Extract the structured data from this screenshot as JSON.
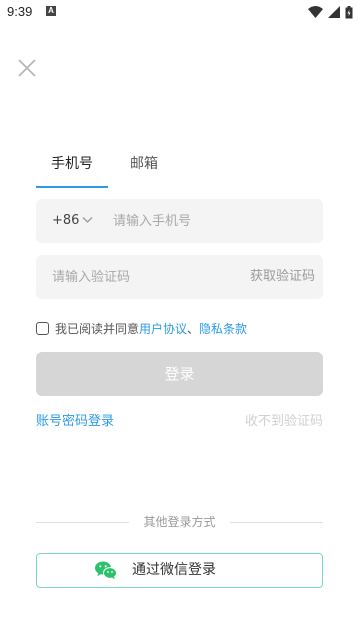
{
  "status_bar": {
    "time": "9:39",
    "notification_badge": "A"
  },
  "tabs": [
    {
      "label": "手机号",
      "active": true
    },
    {
      "label": "邮箱",
      "active": false
    }
  ],
  "phone_field": {
    "country_code": "+86",
    "placeholder": "请输入手机号",
    "value": ""
  },
  "code_field": {
    "placeholder": "请输入验证码",
    "value": "",
    "get_code_label": "获取验证码"
  },
  "agreement": {
    "prefix": "我已阅读并同意",
    "terms_link": "用户协议",
    "separator": "、",
    "privacy_link": "隐私条款",
    "checked": false
  },
  "login_button": {
    "label": "登录"
  },
  "links": {
    "password_login": "账号密码登录",
    "no_code": "收不到验证码"
  },
  "other_login": {
    "divider_text": "其他登录方式",
    "wechat_label": "通过微信登录"
  },
  "colors": {
    "accent": "#2b9be6",
    "wechat_green": "#2cc26a",
    "disabled_button": "#d6d6d6"
  }
}
